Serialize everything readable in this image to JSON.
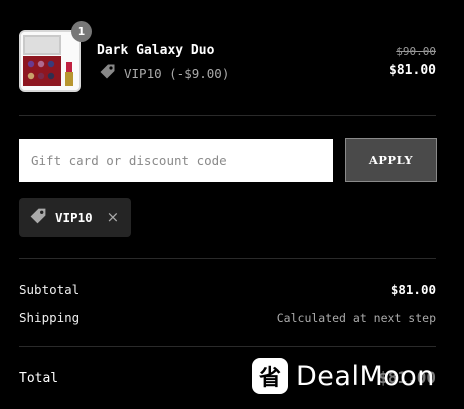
{
  "cart": {
    "quantity": "1",
    "product_name": "Dark Galaxy Duo",
    "discount_line": "VIP10 (-$9.00)",
    "original_price": "$90.00",
    "price": "$81.00"
  },
  "discount_form": {
    "placeholder": "Gift card or discount code",
    "apply_label": "APPLY"
  },
  "applied_code": {
    "code": "VIP10",
    "remove_glyph": "×"
  },
  "summary": {
    "subtotal_label": "Subtotal",
    "subtotal_value": "$81.00",
    "shipping_label": "Shipping",
    "shipping_value": "Calculated at next step",
    "total_label": "Total",
    "total_value": "$81.00"
  },
  "watermark": {
    "logo_glyph": "省",
    "text": "DealMoon"
  },
  "colors": {
    "background": "#000000",
    "chip_bg": "#252525",
    "button_bg": "#4a4a4a",
    "badge_bg": "#777777"
  },
  "icons": [
    "tag-icon",
    "close-icon"
  ]
}
